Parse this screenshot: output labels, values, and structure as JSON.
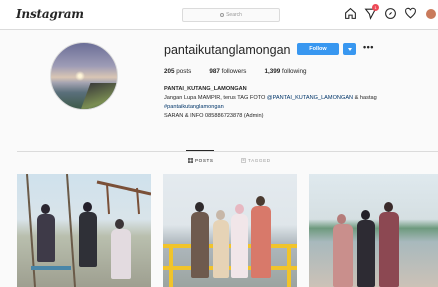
{
  "nav": {
    "logo": "Instagram",
    "search_placeholder": "Search",
    "notifications_count": "1"
  },
  "profile": {
    "username": "pantaikutanglamongan",
    "follow_label": "Follow",
    "stats": {
      "posts_count": "205",
      "posts_label": "posts",
      "followers_count": "987",
      "followers_label": "followers",
      "following_count": "1,399",
      "following_label": "following"
    },
    "bio": {
      "name": "PANTAI_KUTANG_LAMONGAN",
      "line1_prefix": "Jangan Lupa MAMPIR, terus TAG FOTO ",
      "line1_mention": "@PANTAI_KUTANG_LAMONGAN",
      "line1_suffix": " & hastag",
      "hashtag": "#pantaikutanglamongan",
      "info": "SARAN & INFO 085886723878 (Admin)"
    }
  },
  "tabs": [
    {
      "label": "POSTS"
    },
    {
      "label": "TAGGED"
    }
  ],
  "colors": {
    "accent": "#3897f0",
    "badge": "#ed4956",
    "link": "#003569"
  }
}
